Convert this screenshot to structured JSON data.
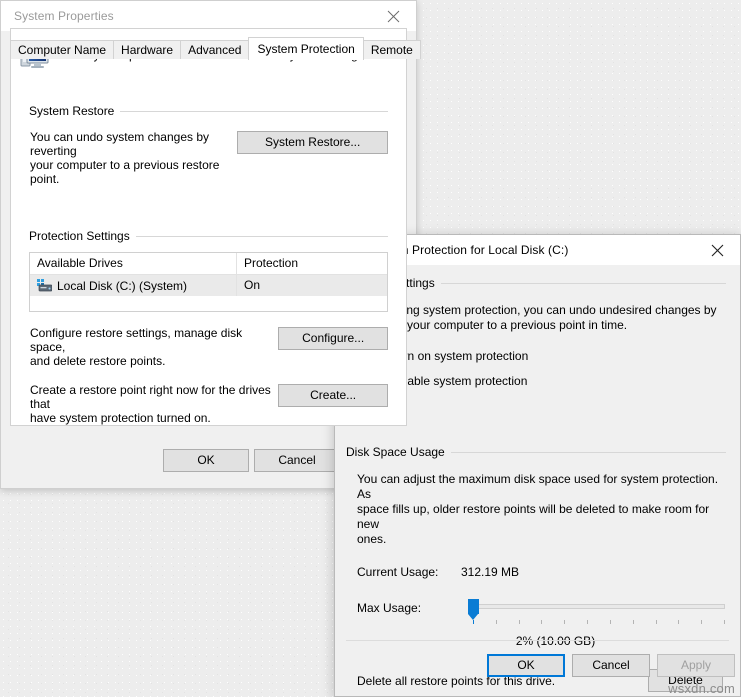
{
  "system_properties": {
    "title": "System Properties",
    "close_label": "✕",
    "tabs": [
      {
        "label": "Computer Name",
        "active": false
      },
      {
        "label": "Hardware",
        "active": false
      },
      {
        "label": "Advanced",
        "active": false
      },
      {
        "label": "System Protection",
        "active": true
      },
      {
        "label": "Remote",
        "active": false
      }
    ],
    "hero_text": "Use system protection to undo unwanted system changes.",
    "system_restore": {
      "group_label": "System Restore",
      "description_line1": "You can undo system changes by reverting",
      "description_line2": "your computer to a previous restore point.",
      "button_label": "System Restore..."
    },
    "protection_settings": {
      "group_label": "Protection Settings",
      "columns": [
        "Available Drives",
        "Protection"
      ],
      "rows": [
        {
          "drive": "Local Disk (C:) (System)",
          "protection": "On"
        }
      ],
      "configure_desc_line1": "Configure restore settings, manage disk space,",
      "configure_desc_line2": "and delete restore points.",
      "configure_button_label": "Configure...",
      "create_desc_line1": "Create a restore point right now for the drives that",
      "create_desc_line2": "have system protection turned on.",
      "create_button_label": "Create..."
    },
    "footer": {
      "ok_label": "OK",
      "cancel_label": "Cancel"
    }
  },
  "protect_dialog": {
    "title": "System Protection for Local Disk (C:)",
    "close_label": "✕",
    "restore_settings": {
      "group_label": "Restore Settings",
      "description_line1": "By enabling system protection, you can undo undesired changes by",
      "description_line2": "reverting your computer to a previous point in time.",
      "options": [
        {
          "label": "Turn on system protection",
          "selected": true
        },
        {
          "label": "Disable system protection",
          "selected": false
        }
      ]
    },
    "disk_space_usage": {
      "group_label": "Disk Space Usage",
      "description_line1": "You can adjust the maximum disk space used for system protection. As",
      "description_line2": "space fills up, older restore points will be deleted to make room for new",
      "description_line3": "ones.",
      "current_usage_label": "Current Usage:",
      "current_usage_value": "312.19 MB",
      "max_usage_label": "Max Usage:",
      "max_usage_value": "2% (10.00 GB)",
      "slider_percent": 2,
      "delete_desc": "Delete all restore points for this drive.",
      "delete_button_label": "Delete"
    },
    "footer": {
      "ok_label": "OK",
      "cancel_label": "Cancel",
      "apply_label": "Apply"
    }
  },
  "watermark": "wsxdn.com",
  "colors": {
    "accent": "#0078d7",
    "slider": "#0a7cd4",
    "window_bg": "#f0f0f0",
    "page_bg": "#ffffff"
  }
}
